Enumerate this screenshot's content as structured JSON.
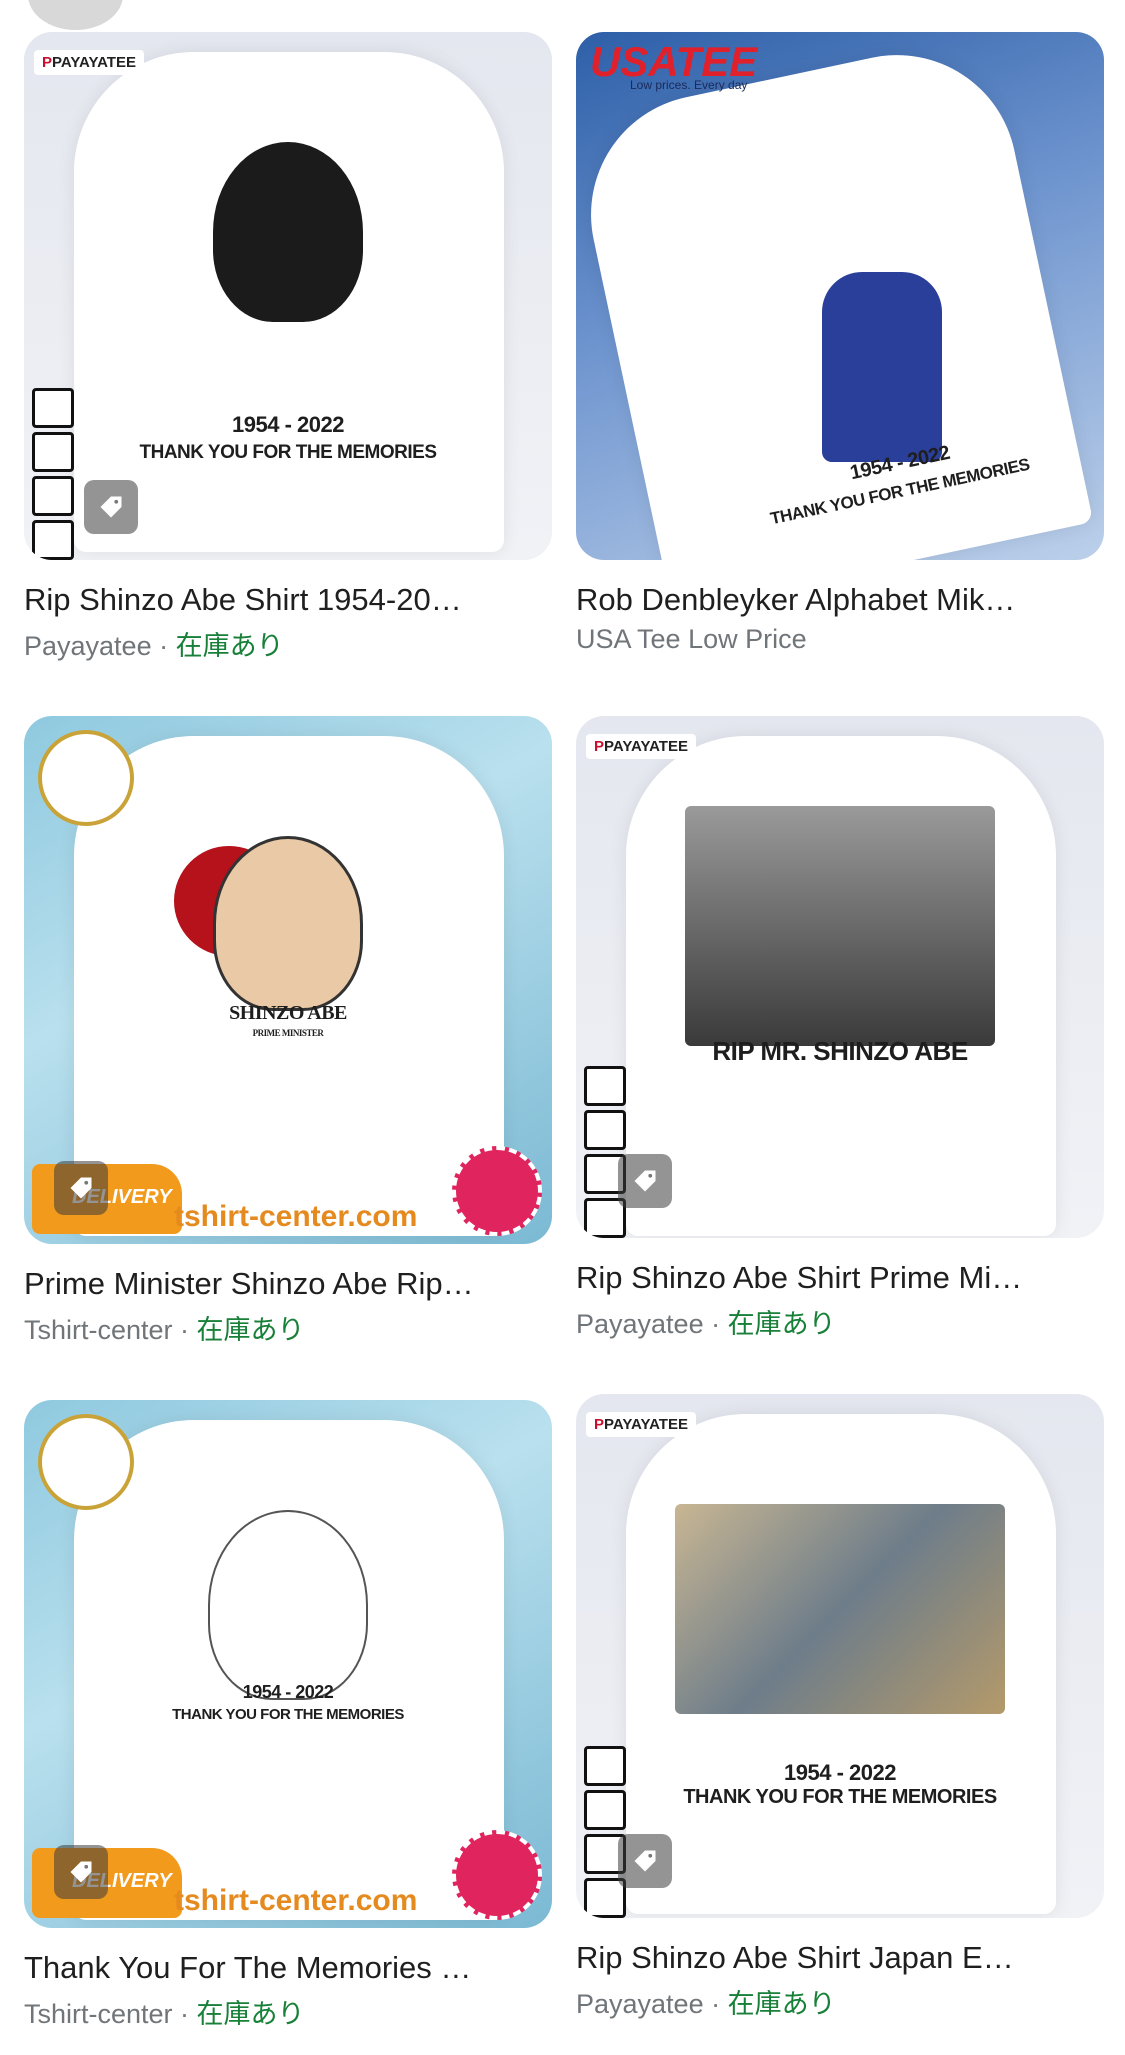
{
  "cards": [
    {
      "title": "Rip Shinzo Abe Shirt 1954-20…",
      "source": "Payayatee",
      "separator": " · ",
      "stock": "在庫あり",
      "print_line1": "1954 - 2022",
      "print_line2": "THANK YOU FOR THE MEMORIES",
      "brand_badge": "PAYAYATEE"
    },
    {
      "title": "Rob Denbleyker Alphabet Mik…",
      "source": "USA Tee Low Price",
      "print_line1": "1954 - 2022",
      "print_line2": "THANK YOU FOR THE MEMORIES",
      "brand_logo": "USATEE",
      "brand_sub": "Low prices. Every day"
    },
    {
      "title": "Prime Minister Shinzo Abe Rip…",
      "source": "Tshirt-center",
      "separator": " · ",
      "stock": "在庫あり",
      "print_line1": "SHINZO ABE",
      "print_line2": "PRIME MINISTER",
      "watermark": "tshirt-center.com",
      "delivery": "DELIVERY"
    },
    {
      "title": "Rip Shinzo Abe Shirt Prime Mi…",
      "source": "Payayatee",
      "separator": " · ",
      "stock": "在庫あり",
      "print_line1": "RIP MR. SHINZO ABE",
      "brand_badge": "PAYAYATEE"
    },
    {
      "title": "Thank You For The Memories …",
      "source": "Tshirt-center",
      "separator": " · ",
      "stock": "在庫あり",
      "print_line1": "1954 - 2022",
      "print_line2": "THANK YOU FOR THE MEMORIES",
      "watermark": "tshirt-center.com",
      "delivery": "DELIVERY"
    },
    {
      "title": "Rip Shinzo Abe Shirt Japan E…",
      "source": "Payayatee",
      "separator": " · ",
      "stock": "在庫あり",
      "print_line1": "1954 - 2022",
      "print_line2": "THANK YOU FOR THE MEMORIES",
      "brand_badge": "PAYAYATEE"
    }
  ],
  "colors": {
    "title": "#1f1f1f",
    "source": "#70757a",
    "stock": "#188038"
  },
  "icons": [
    "shopping-tag-icon",
    "size-chart-icon"
  ]
}
